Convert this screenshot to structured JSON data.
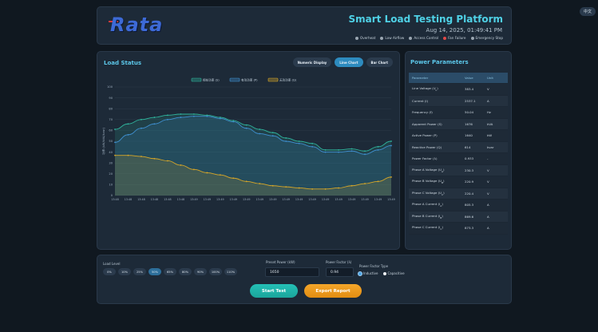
{
  "lang_button": "中文",
  "header": {
    "logo": "Rata",
    "title": "Smart Load Testing Platform",
    "datetime": "Aug 14, 2025, 01:49:41 PM",
    "status": [
      {
        "label": "Overheat",
        "color": "#9aa6b2"
      },
      {
        "label": "Low Airflow",
        "color": "#9aa6b2"
      },
      {
        "label": "Access Control",
        "color": "#9aa6b2"
      },
      {
        "label": "Fan Failure",
        "color": "#e04848"
      },
      {
        "label": "Emergency Stop",
        "color": "#9aa6b2"
      }
    ]
  },
  "load_status": {
    "title": "Load Status",
    "tabs": [
      "Numeric Display",
      "Line Chart",
      "Bar Chart"
    ],
    "active_tab": "Line Chart"
  },
  "chart_data": {
    "type": "area",
    "x": [
      "13:48",
      "13:48",
      "13:48",
      "13:48",
      "13:48",
      "13:48",
      "13:49",
      "13:49",
      "13:49",
      "13:49",
      "13:49",
      "13:49",
      "13:49",
      "13:49",
      "13:49",
      "13:49",
      "13:49",
      "13:49",
      "13:49",
      "13:49",
      "13:49",
      "13:49"
    ],
    "ylim": [
      0,
      100
    ],
    "yticks": [
      0,
      10,
      20,
      30,
      40,
      50,
      60,
      70,
      80,
      90,
      100
    ],
    "ylabel": "功率 (kW/kVA/kvar)",
    "legend_position": "top-center",
    "grid": true,
    "series": [
      {
        "name": "视在功率 (S)",
        "color": "#2fb39c",
        "values": [
          61,
          66,
          70,
          72,
          74,
          75,
          75,
          74,
          72,
          69,
          65,
          61,
          58,
          53,
          50,
          48,
          42,
          42,
          43,
          41,
          45,
          50
        ]
      },
      {
        "name": "有功功率 (P)",
        "color": "#3f8fd0",
        "values": [
          49,
          56,
          62,
          66,
          70,
          72,
          73,
          73,
          71,
          68,
          62,
          57,
          55,
          50,
          48,
          45,
          40,
          40,
          41,
          38,
          42,
          46
        ]
      },
      {
        "name": "无功功率 (Q)",
        "color": "#d6a628",
        "values": [
          37,
          37,
          36,
          34,
          32,
          28,
          24,
          21,
          19,
          16,
          13,
          11,
          9,
          8,
          7,
          6,
          6,
          7,
          9,
          11,
          13,
          17
        ]
      }
    ]
  },
  "power_parameters": {
    "title": "Power Parameters",
    "headers": [
      "Parameter",
      "Value",
      "Unit"
    ],
    "rows": [
      {
        "name": "Line Voltage (U",
        "sub": "L",
        "tail": ")",
        "value": "383.4",
        "unit": "V"
      },
      {
        "name": "Current (I)",
        "sub": "",
        "tail": "",
        "value": "2537.1",
        "unit": "A"
      },
      {
        "name": "Frequency (f)",
        "sub": "",
        "tail": "",
        "value": "50.04",
        "unit": "Hz"
      },
      {
        "name": "Apparent Power (S)",
        "sub": "",
        "tail": "",
        "value": "1676",
        "unit": "kVA"
      },
      {
        "name": "Active Power (P)",
        "sub": "",
        "tail": "",
        "value": "1640",
        "unit": "kW"
      },
      {
        "name": "Reactive Power (Q)",
        "sub": "",
        "tail": "",
        "value": "614",
        "unit": "kvar"
      },
      {
        "name": "Power Factor (λ)",
        "sub": "",
        "tail": "",
        "value": "0.933",
        "unit": "-"
      },
      {
        "name": "Phase A Voltage (U",
        "sub": "A",
        "tail": ")",
        "value": "230.3",
        "unit": "V"
      },
      {
        "name": "Phase B Voltage (U",
        "sub": "B",
        "tail": ")",
        "value": "220.9",
        "unit": "V"
      },
      {
        "name": "Phase C Voltage (U",
        "sub": "C",
        "tail": ")",
        "value": "220.4",
        "unit": "V"
      },
      {
        "name": "Phase A Current (I",
        "sub": "A",
        "tail": ")",
        "value": "805.3",
        "unit": "A"
      },
      {
        "name": "Phase B Current (I",
        "sub": "B",
        "tail": ")",
        "value": "869.6",
        "unit": "A"
      },
      {
        "name": "Phase C Current (I",
        "sub": "C",
        "tail": ")",
        "value": "873.3",
        "unit": "A"
      }
    ]
  },
  "controls": {
    "load_level_label": "Load Level",
    "load_levels": [
      "0%",
      "10%",
      "25%",
      "50%",
      "65%",
      "80%",
      "90%",
      "100%",
      "110%"
    ],
    "active_level": "50%",
    "preset_power_label": "Preset Power (kW)",
    "preset_power_value": "1650",
    "power_factor_label": "Power Factor (λ)",
    "power_factor_value": "0.94",
    "pf_type_label": "Power Factor Type",
    "pf_types": [
      "Inductive",
      "Capacitive"
    ],
    "pf_selected": "Inductive",
    "start_label": "Start Test",
    "export_label": "Export Report"
  }
}
